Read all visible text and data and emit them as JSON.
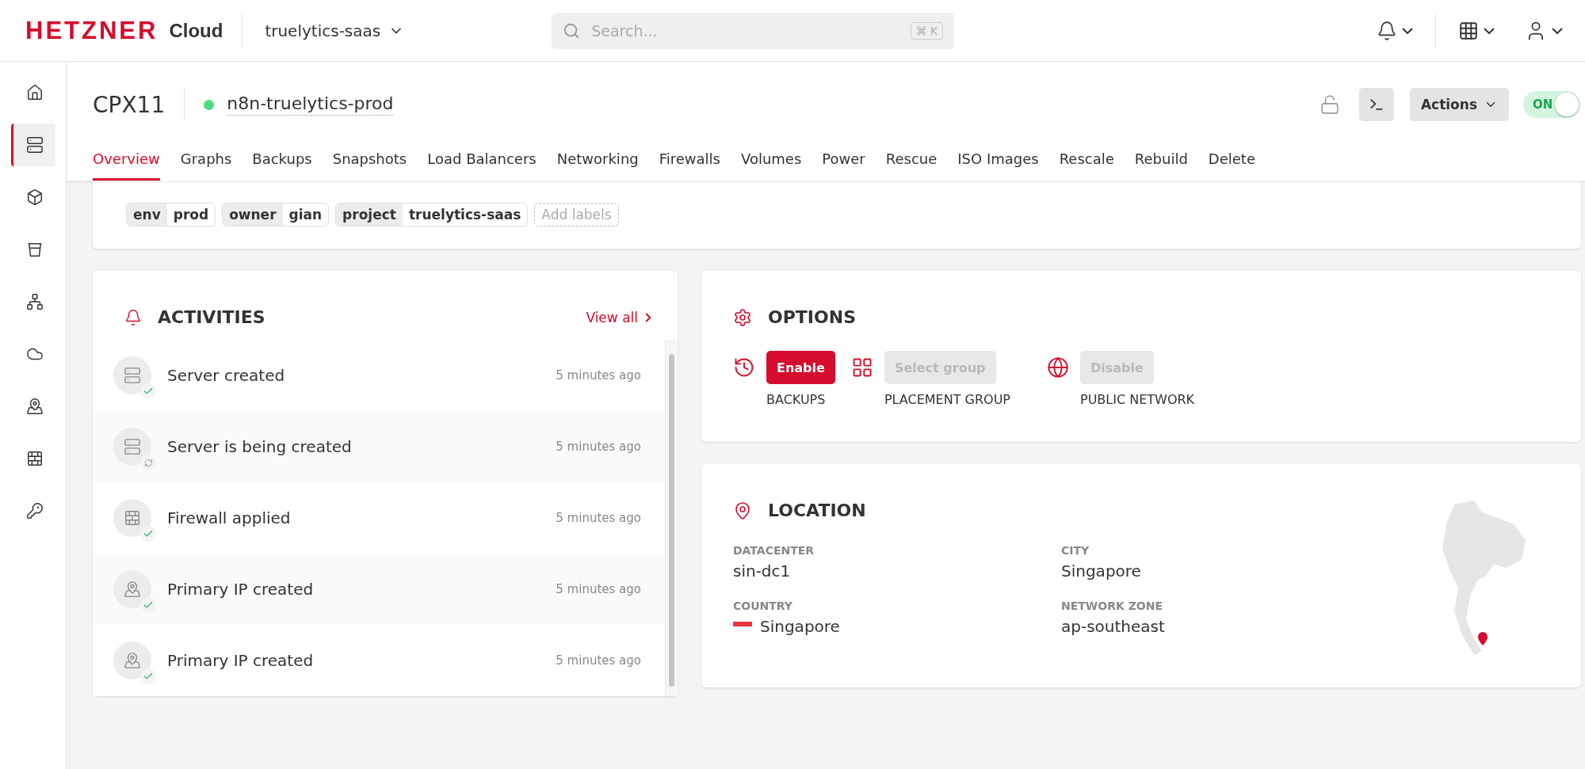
{
  "brand": {
    "name": "HETZNER",
    "product": "Cloud"
  },
  "project": {
    "name": "truelytics-saas"
  },
  "search": {
    "placeholder": "Search...",
    "shortcut": "⌘ K"
  },
  "sidebar": {
    "items": [
      {
        "kind": "home",
        "selected": false
      },
      {
        "kind": "servers",
        "selected": true
      },
      {
        "kind": "box",
        "selected": false
      },
      {
        "kind": "bucket",
        "selected": false
      },
      {
        "kind": "balancer",
        "selected": false
      },
      {
        "kind": "cloud",
        "selected": false
      },
      {
        "kind": "ip",
        "selected": false
      },
      {
        "kind": "firewall",
        "selected": false
      },
      {
        "kind": "key",
        "selected": false
      }
    ]
  },
  "server": {
    "type": "CPX11",
    "name": "n8n-truelytics-prod",
    "online": true,
    "locked": false,
    "actions": "Actions",
    "power": {
      "label": "ON",
      "on": true
    }
  },
  "tabs": [
    {
      "label": "Overview",
      "selected": true
    },
    {
      "label": "Graphs",
      "selected": false
    },
    {
      "label": "Backups",
      "selected": false
    },
    {
      "label": "Snapshots",
      "selected": false
    },
    {
      "label": "Load Balancers",
      "selected": false
    },
    {
      "label": "Networking",
      "selected": false
    },
    {
      "label": "Firewalls",
      "selected": false
    },
    {
      "label": "Volumes",
      "selected": false
    },
    {
      "label": "Power",
      "selected": false
    },
    {
      "label": "Rescue",
      "selected": false
    },
    {
      "label": "ISO Images",
      "selected": false
    },
    {
      "label": "Rescale",
      "selected": false
    },
    {
      "label": "Rebuild",
      "selected": false
    },
    {
      "label": "Delete",
      "selected": false
    }
  ],
  "labels": {
    "items": [
      {
        "key": "env",
        "value": "prod"
      },
      {
        "key": "owner",
        "value": "gian"
      },
      {
        "key": "project",
        "value": "truelytics-saas"
      }
    ],
    "add": "Add labels"
  },
  "activities": {
    "title": "ACTIVITIES",
    "view_all": "View all",
    "items": [
      {
        "kind": "server",
        "done": true,
        "text": "Server created",
        "time": "5 minutes ago"
      },
      {
        "kind": "server",
        "done": false,
        "text": "Server is being created",
        "time": "5 minutes ago"
      },
      {
        "kind": "firewall",
        "done": true,
        "text": "Firewall applied",
        "time": "5 minutes ago"
      },
      {
        "kind": "ip",
        "done": true,
        "text": "Primary IP created",
        "time": "5 minutes ago"
      },
      {
        "kind": "ip",
        "done": true,
        "text": "Primary IP created",
        "time": "5 minutes ago"
      }
    ]
  },
  "options": {
    "title": "OPTIONS",
    "items": [
      {
        "kind": "backups",
        "button": "Enable",
        "disabled": false,
        "label": "BACKUPS"
      },
      {
        "kind": "placement",
        "button": "Select group",
        "disabled": true,
        "label": "PLACEMENT GROUP"
      },
      {
        "kind": "network",
        "button": "Disable",
        "disabled": true,
        "label": "PUBLIC NETWORK"
      }
    ]
  },
  "location": {
    "title": "LOCATION",
    "fields": [
      {
        "label": "DATACENTER",
        "value": "sin-dc1",
        "flag": false
      },
      {
        "label": "CITY",
        "value": "Singapore",
        "flag": false
      },
      {
        "label": "COUNTRY",
        "value": "Singapore",
        "flag": true
      },
      {
        "label": "NETWORK ZONE",
        "value": "ap-southeast",
        "flag": false
      }
    ]
  }
}
